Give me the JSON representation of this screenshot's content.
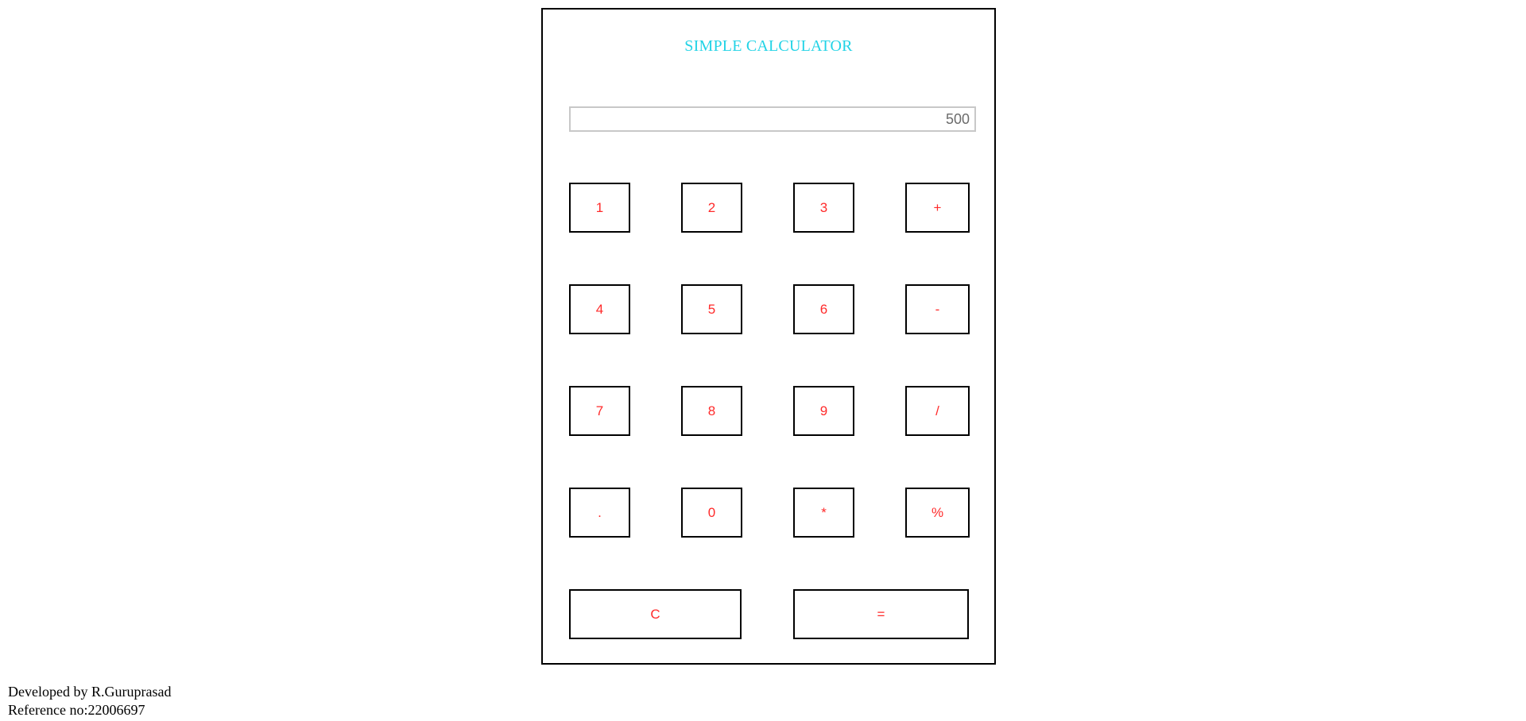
{
  "calculator": {
    "title": "SIMPLE CALCULATOR",
    "display_value": "500",
    "buttons": {
      "b1": "1",
      "b2": "2",
      "b3": "3",
      "plus": "+",
      "b4": "4",
      "b5": "5",
      "b6": "6",
      "minus": "-",
      "b7": "7",
      "b8": "8",
      "b9": "9",
      "divide": "/",
      "dot": ".",
      "b0": "0",
      "multiply": "*",
      "percent": "%",
      "clear": "C",
      "equals": "="
    }
  },
  "footer": {
    "developer": "Developed by R.Guruprasad",
    "reference": "Reference no:22006697"
  },
  "colors": {
    "title": "#22d3e6",
    "button_text": "#ff2a2a",
    "border": "#000000",
    "display_text": "#6b6b6b"
  }
}
